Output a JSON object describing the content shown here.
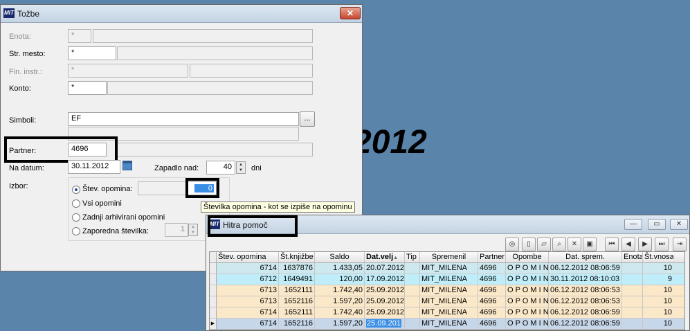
{
  "background": {
    "year_text": "2012",
    "color": "#5b84ab"
  },
  "tozbe": {
    "title": "Tožbe",
    "close": "✕",
    "labels": {
      "enota": "Enota:",
      "str_mesto": "Str. mesto:",
      "fin_instr": "Fin. instr.:",
      "konto": "Konto:",
      "simboli": "Simboli:",
      "partner": "Partner:",
      "na_datum": "Na datum:",
      "zapadlo_nad": "Zapadlo nad:",
      "dni": "dni",
      "izbor": "Izbor:"
    },
    "fields": {
      "enota": "*",
      "str_mesto": "*",
      "fin_instr": "*",
      "konto": "*",
      "simboli": "EF",
      "partner": "4696",
      "na_datum": "30.11.2012",
      "zapadlo_nad": "40",
      "st_opomina_value": "0",
      "zaporedna_value": "1"
    },
    "ellipsis": "...",
    "radios": {
      "st_opomina": "Štev. opomina:",
      "vsi": "Vsi opomini",
      "zadnji": "Zadnji arhivirani opomini",
      "zaporedna": "Zaporedna številka:"
    },
    "tooltip": "Številka opomina - kot se izpiše na opominu"
  },
  "hitra": {
    "title": "Hitra pomoč",
    "columns": [
      "Štev. opomina",
      "Št.knjižbe",
      "Saldo",
      "Dat.velj",
      "Tip",
      "Spremenil",
      "Partner",
      "Opombe",
      "Dat. sprem.",
      "Enota",
      "Št.vnosa"
    ],
    "rows": [
      {
        "cells": [
          "6714",
          "1637876",
          "1.433,05",
          "20.07.2012",
          "",
          "MIT_MILENA",
          "4696",
          "O P O M I N",
          "06.12.2012 08:06:59",
          "",
          "10"
        ],
        "bg": "#cde9ef"
      },
      {
        "cells": [
          "6712",
          "1649491",
          "120,00",
          "17.09.2012",
          "",
          "MIT_MILENA",
          "4696",
          "O P O M I N",
          "30.11.2012 08:10:03",
          "",
          "9"
        ],
        "bg": "#bfeefa"
      },
      {
        "cells": [
          "6713",
          "1652111",
          "1.742,40",
          "25.09.2012",
          "",
          "MIT_MILENA",
          "4696",
          "O P O M I N",
          "06.12.2012 08:06:53",
          "",
          "10"
        ],
        "bg": "#fbe8c8"
      },
      {
        "cells": [
          "6713",
          "1652116",
          "1.597,20",
          "25.09.2012",
          "",
          "MIT_MILENA",
          "4696",
          "O P O M I N",
          "06.12.2012 08:06:53",
          "",
          "10"
        ],
        "bg": "#fbe8c8"
      },
      {
        "cells": [
          "6714",
          "1652111",
          "1.742,40",
          "25.09.2012",
          "",
          "MIT_MILENA",
          "4696",
          "O P O M I N",
          "06.12.2012 08:06:59",
          "",
          "10"
        ],
        "bg": "#fbe8c8"
      },
      {
        "cells": [
          "6714",
          "1652116",
          "1.597,20",
          "25.09.201",
          "",
          "MIT_MILENA",
          "4696",
          "O P O M I N",
          "06.12.2012 08:06:59",
          "",
          "10"
        ],
        "bg": "#c7d7ea"
      }
    ]
  }
}
